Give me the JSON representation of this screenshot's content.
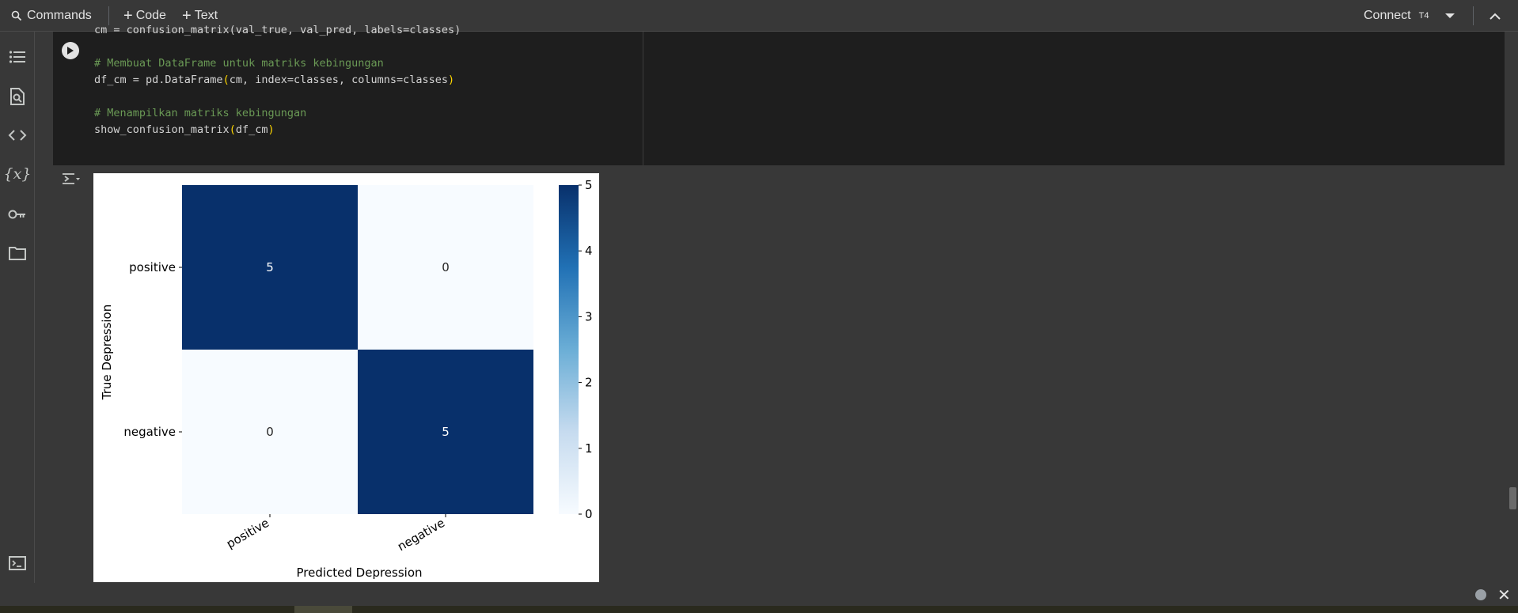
{
  "toolbar": {
    "commands_label": "Commands",
    "code_label": "Code",
    "text_label": "Text",
    "connect_label": "Connect",
    "runtime_label": "T4"
  },
  "sidebar": {
    "items": [
      {
        "icon": "table-of-contents-icon"
      },
      {
        "icon": "find-replace-icon"
      },
      {
        "icon": "code-snippets-icon"
      },
      {
        "icon": "variables-icon"
      },
      {
        "icon": "secrets-key-icon"
      },
      {
        "icon": "files-folder-icon"
      }
    ],
    "bottom_icon": "terminal-icon"
  },
  "code_cell": {
    "line1": "cm = confusion_matrix(val_true, val_pred, labels=classes)",
    "comment1": "# Membuat DataFrame untuk matriks kebingungan",
    "line2_pre": "df_cm = pd.DataFrame",
    "line2_open": "(",
    "line2_mid": "cm, index=classes, columns=classes",
    "line2_close": ")",
    "comment2": "# Menampilkan matriks kebingungan",
    "line3_pre": "show_confusion_matrix",
    "line3_open": "(",
    "line3_mid": "df_cm",
    "line3_close": ")"
  },
  "colors": {
    "dark_cell": "#08306b",
    "light_cell": "#f7fbff",
    "code_bg": "#1e1e1e",
    "comment": "#6a9955",
    "paren": "#ffd700"
  },
  "chart_data": {
    "type": "heatmap",
    "title": "",
    "xlabel": "Predicted Depression",
    "ylabel": "True Depression",
    "x_categories": [
      "positive",
      "negative"
    ],
    "y_categories": [
      "positive",
      "negative"
    ],
    "values": [
      [
        5,
        0
      ],
      [
        0,
        5
      ]
    ],
    "colorbar": {
      "min": 0,
      "max": 5,
      "ticks": [
        "0",
        "1",
        "2",
        "3",
        "4",
        "5"
      ],
      "colormap": "Blues"
    },
    "annotations": [
      [
        "5",
        "0"
      ],
      [
        "0",
        "5"
      ]
    ]
  }
}
